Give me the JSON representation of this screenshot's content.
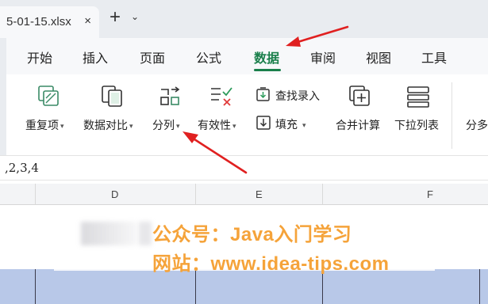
{
  "tab": {
    "file_name": "5-01-15.xlsx",
    "close": "×",
    "new_tab": "+",
    "new_tab_menu": "⌄"
  },
  "menu": {
    "items": [
      "开始",
      "插入",
      "页面",
      "公式",
      "数据",
      "审阅",
      "视图",
      "工具"
    ],
    "active": "数据"
  },
  "ribbon": {
    "buttons": [
      {
        "label": "重复项",
        "icon": "duplicate-icon",
        "has_menu": true
      },
      {
        "label": "数据对比",
        "icon": "data-compare-icon",
        "has_menu": true
      },
      {
        "label": "分列",
        "icon": "split-column-icon",
        "has_menu": true
      },
      {
        "label": "有效性",
        "icon": "validation-icon",
        "has_menu": true
      },
      {
        "label": "查找录入",
        "icon": "lookup-entry-icon",
        "has_menu": false
      },
      {
        "label": "填充",
        "icon": "fill-icon",
        "has_menu": true
      },
      {
        "label": "合并计算",
        "icon": "consolidate-icon",
        "has_menu": false
      },
      {
        "label": "下拉列表",
        "icon": "dropdown-list-icon",
        "has_menu": false
      },
      {
        "label": "分多",
        "icon": "",
        "has_menu": false
      }
    ]
  },
  "formula": {
    "value": ",2,3,4"
  },
  "grid": {
    "columns": [
      "D",
      "E",
      "F"
    ]
  },
  "watermark": {
    "line1": "公众号：Java入门学习",
    "line2": "网站：www.idea-tips.com",
    "color": "#f5a33a"
  },
  "annotation": {
    "arrow_color": "#e02020"
  },
  "colors": {
    "accent": "#1a7f4b",
    "selection": "#b8c8e8"
  }
}
